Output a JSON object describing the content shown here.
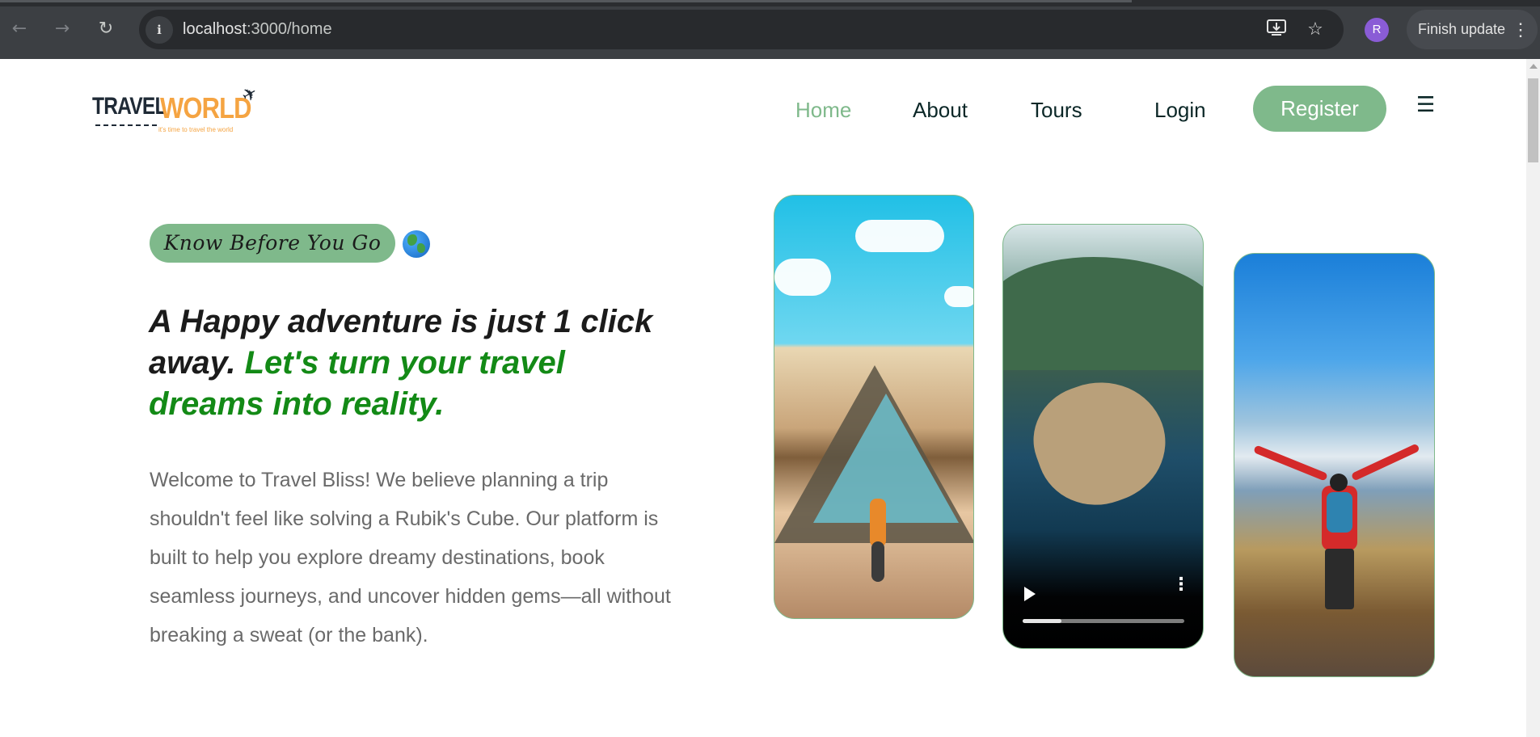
{
  "browser": {
    "url_host": "localhost",
    "url_path": ":3000/home",
    "profile_initial": "R",
    "finish_update_label": "Finish update",
    "icons": [
      "back-icon",
      "forward-icon",
      "reload-icon",
      "info-icon",
      "install-app-icon",
      "bookmark-star-icon",
      "more-icon"
    ]
  },
  "header": {
    "logo_travel": "TRAVEL",
    "logo_world": "WORLD",
    "logo_tagline": "it's time to travel the world",
    "nav": [
      "Home",
      "About",
      "Tours"
    ],
    "active_nav": "Home",
    "login_label": "Login",
    "register_label": "Register",
    "menu_icon": "☰"
  },
  "hero": {
    "badge": "Know Before You Go",
    "headline_dark": "A Happy adventure is just 1 click away.",
    "headline_green": "Let's turn your travel dreams into reality.",
    "intro": "Welcome to Travel Bliss! We believe planning a trip shouldn't feel like solving a Rubik's Cube. Our platform is built to help you explore dreamy destinations, book seamless journeys, and uncover hidden gems—all without breaking a sweat (or the bank).",
    "video_progress": 0.24
  },
  "colors": {
    "accent_green": "#7fb98b",
    "headline_green": "#138a16",
    "logo_orange": "#f5a442",
    "nav_text": "#0b2727"
  }
}
